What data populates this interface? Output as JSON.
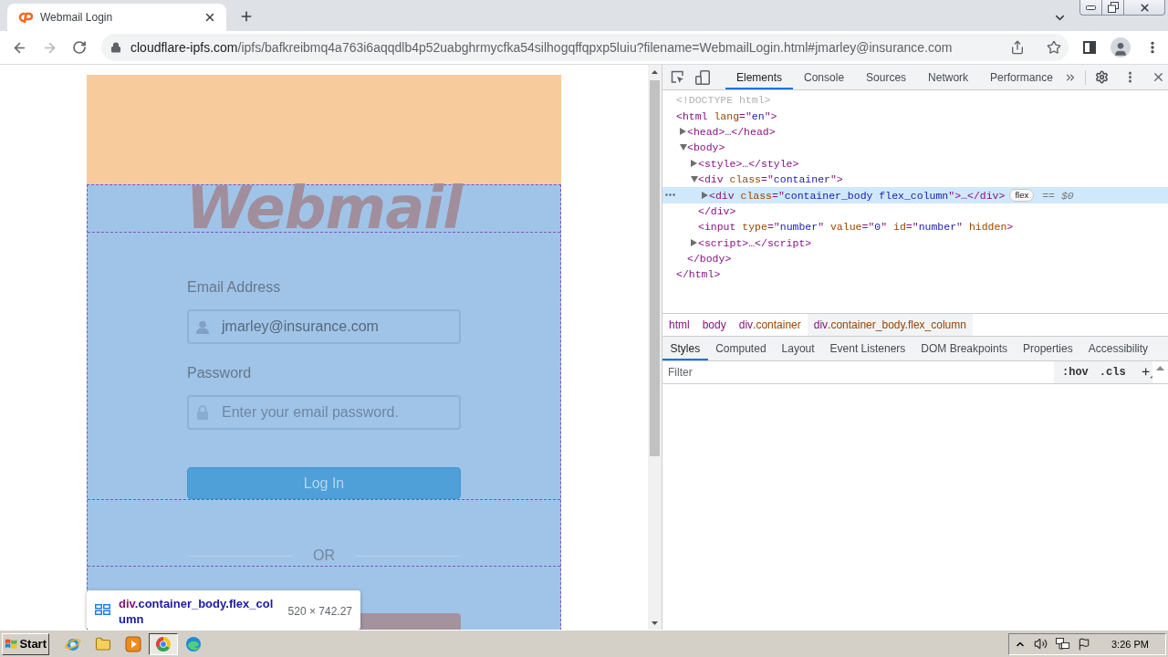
{
  "browser": {
    "tab": {
      "title": "Webmail Login",
      "selected": true
    },
    "address": {
      "host": "cloudflare-ipfs.com",
      "path": "/ipfs/bafkreibmq4a763i6aqqdlb4p52uabghrmycfka54silhogqffqpxp5luiu?filename=WebmailLogin.html#jmarley@insurance.com"
    }
  },
  "page": {
    "inspect_overlay": true,
    "logo": "Webmail",
    "email": {
      "label": "Email Address",
      "value": "jmarley@insurance.com"
    },
    "password": {
      "label": "Password",
      "placeholder": "Enter your email password."
    },
    "login_button": "Log In",
    "separator": "OR",
    "element_tooltip": {
      "tag": "div",
      "classes": ".container_body.flex_column",
      "size": "520 × 742.27"
    }
  },
  "devtools": {
    "tabs": [
      {
        "label": "Elements",
        "selected": true
      },
      {
        "label": "Console",
        "selected": false
      },
      {
        "label": "Sources",
        "selected": false
      },
      {
        "label": "Network",
        "selected": false
      },
      {
        "label": "Performance",
        "selected": false
      }
    ],
    "dom_tree": [
      {
        "selected": false,
        "tokens": [
          {
            "kind": "doctype",
            "text": "<!DOCTYPE html>"
          }
        ]
      },
      {
        "selected": false,
        "tokens": [
          {
            "kind": "tag",
            "text": "<html "
          },
          {
            "kind": "attr",
            "text": "lang"
          },
          {
            "kind": "tag",
            "text": "=\""
          },
          {
            "kind": "value",
            "text": "en"
          },
          {
            "kind": "tag",
            "text": "\">"
          }
        ],
        "children": [
          {
            "selected": false,
            "expanded": false,
            "tokens": [
              {
                "kind": "tag",
                "text": "<head>…</head>"
              }
            ]
          },
          {
            "selected": false,
            "expanded": true,
            "tokens": [
              {
                "kind": "tag",
                "text": "<body>"
              }
            ],
            "children": [
              {
                "selected": false,
                "expanded": false,
                "tokens": [
                  {
                    "kind": "tag",
                    "text": "<style>…</style>"
                  }
                ]
              },
              {
                "selected": false,
                "expanded": true,
                "tokens": [
                  {
                    "kind": "tag",
                    "text": "<div "
                  },
                  {
                    "kind": "attr",
                    "text": "class"
                  },
                  {
                    "kind": "tag",
                    "text": "=\""
                  },
                  {
                    "kind": "value",
                    "text": "container"
                  },
                  {
                    "kind": "tag",
                    "text": "\">"
                  }
                ],
                "children": [
                  {
                    "selected": true,
                    "expanded": false,
                    "tokens": [
                      {
                        "kind": "tag",
                        "text": "<div "
                      },
                      {
                        "kind": "attr",
                        "text": "class"
                      },
                      {
                        "kind": "tag",
                        "text": "=\""
                      },
                      {
                        "kind": "value",
                        "text": "container_body flex_column"
                      },
                      {
                        "kind": "tag",
                        "text": "\">…</div>"
                      }
                    ],
                    "badge": "flex",
                    "suffix": "== *$0*"
                  }
                ],
                "closing": [
                  {
                    "kind": "tag",
                    "text": "</div>"
                  }
                ]
              },
              {
                "selected": false,
                "tokens": [
                  {
                    "kind": "tag",
                    "text": "<input "
                  },
                  {
                    "kind": "attr",
                    "text": "type"
                  },
                  {
                    "kind": "tag",
                    "text": "=\""
                  },
                  {
                    "kind": "value",
                    "text": "number"
                  },
                  {
                    "kind": "tag",
                    "text": "\" "
                  },
                  {
                    "kind": "attr",
                    "text": "value"
                  },
                  {
                    "kind": "tag",
                    "text": "=\""
                  },
                  {
                    "kind": "value",
                    "text": "0"
                  },
                  {
                    "kind": "tag",
                    "text": "\" "
                  },
                  {
                    "kind": "attr",
                    "text": "id"
                  },
                  {
                    "kind": "tag",
                    "text": "=\""
                  },
                  {
                    "kind": "value",
                    "text": "number"
                  },
                  {
                    "kind": "tag",
                    "text": "\" "
                  },
                  {
                    "kind": "attr",
                    "text": "hidden"
                  },
                  {
                    "kind": "tag",
                    "text": ">"
                  }
                ]
              },
              {
                "selected": false,
                "expanded": false,
                "tokens": [
                  {
                    "kind": "tag",
                    "text": "<script>…</script>"
                  }
                ]
              }
            ],
            "closing": [
              {
                "kind": "tag",
                "text": "</body>"
              }
            ]
          }
        ],
        "closing": [
          {
            "kind": "tag",
            "text": "</html>"
          }
        ]
      }
    ],
    "breadcrumbs": [
      {
        "tag": "html",
        "selected": false
      },
      {
        "tag": "body",
        "selected": false
      },
      {
        "tag": "div",
        "class_part": ".container",
        "selected": false
      },
      {
        "tag": "div",
        "class_part": ".container_body.flex_column",
        "selected": true
      }
    ],
    "pane_tabs": [
      {
        "label": "Styles",
        "selected": true
      },
      {
        "label": "Computed",
        "selected": false
      },
      {
        "label": "Layout",
        "selected": false
      },
      {
        "label": "Event Listeners",
        "selected": false
      },
      {
        "label": "DOM Breakpoints",
        "selected": false
      },
      {
        "label": "Properties",
        "selected": false
      },
      {
        "label": "Accessibility",
        "selected": false
      }
    ],
    "filter": {
      "placeholder": "Filter"
    },
    "filter_buttons": [
      ":hov",
      ".cls"
    ]
  },
  "taskbar": {
    "start": "Start",
    "apps": [
      {
        "kind": "globe",
        "selected": false
      },
      {
        "kind": "folder",
        "selected": false
      },
      {
        "kind": "player",
        "selected": false
      },
      {
        "kind": "round",
        "selected": true
      },
      {
        "kind": "swirl",
        "selected": false
      }
    ],
    "clock": "3:26 PM"
  }
}
